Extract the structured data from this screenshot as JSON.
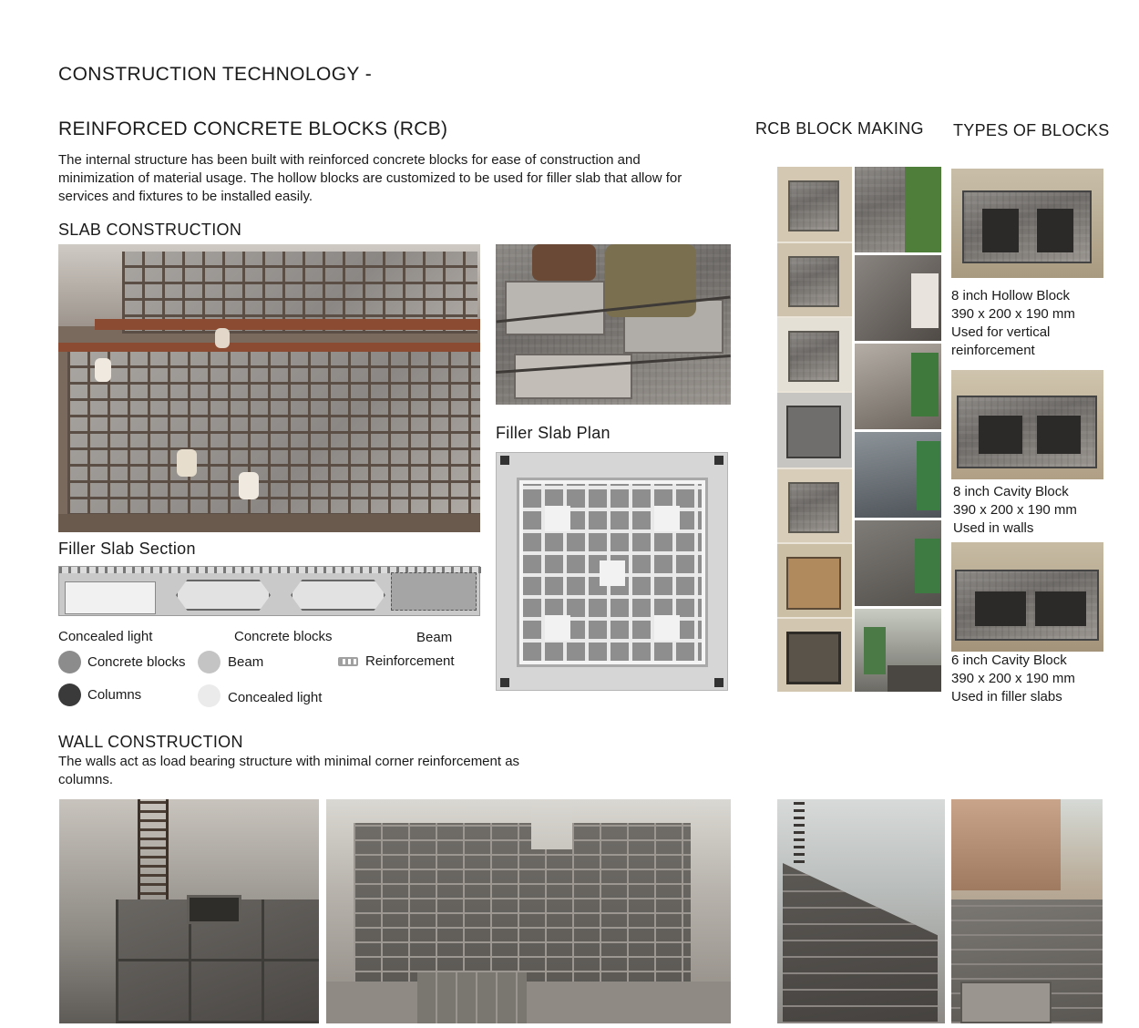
{
  "page_title": "CONSTRUCTION TECHNOLOGY -",
  "rcb": {
    "title": "REINFORCED CONCRETE BLOCKS (RCB)",
    "description_lines": [
      "The internal structure has been built with reinforced concrete blocks for ease of construction and",
      "minimization of material usage. The hollow blocks are customized to be used for filler slab that allow for",
      "services and fixtures to be installed easily."
    ]
  },
  "block_making": {
    "title": "RCB BLOCK MAKING"
  },
  "types": {
    "title": "TYPES OF BLOCKS",
    "items": [
      {
        "name": "8 inch Hollow Block",
        "size": "390 x 200 x 190 mm",
        "use_lines": [
          "Used for vertical",
          "reinforcement"
        ]
      },
      {
        "name": "8 inch Cavity Block",
        "size": "390 x 200 x 190 mm",
        "use_lines": [
          "Used in walls"
        ]
      },
      {
        "name": "6 inch Cavity Block",
        "size": "390 x 200 x 190 mm",
        "use_lines": [
          "Used in filler slabs"
        ]
      }
    ]
  },
  "slab": {
    "title": "SLAB CONSTRUCTION",
    "plan_label": "Filler Slab Plan",
    "section_label": "Filler Slab Section",
    "section_labels": [
      "Concealed light",
      "Concrete blocks",
      "Beam"
    ],
    "legend": [
      {
        "label": "Concrete blocks",
        "color": "#8c8c8c"
      },
      {
        "label": "Beam",
        "color": "#c4c4c4"
      },
      {
        "label": "Reinforcement",
        "color": "#a0a0a0"
      },
      {
        "label": "Columns",
        "color": "#3a3a3a"
      },
      {
        "label": "Concealed light",
        "color": "#ebebeb"
      }
    ]
  },
  "wall": {
    "title": "WALL CONSTRUCTION",
    "description_lines": [
      "The walls act as load bearing structure with minimal corner reinforcement as",
      "columns."
    ]
  }
}
